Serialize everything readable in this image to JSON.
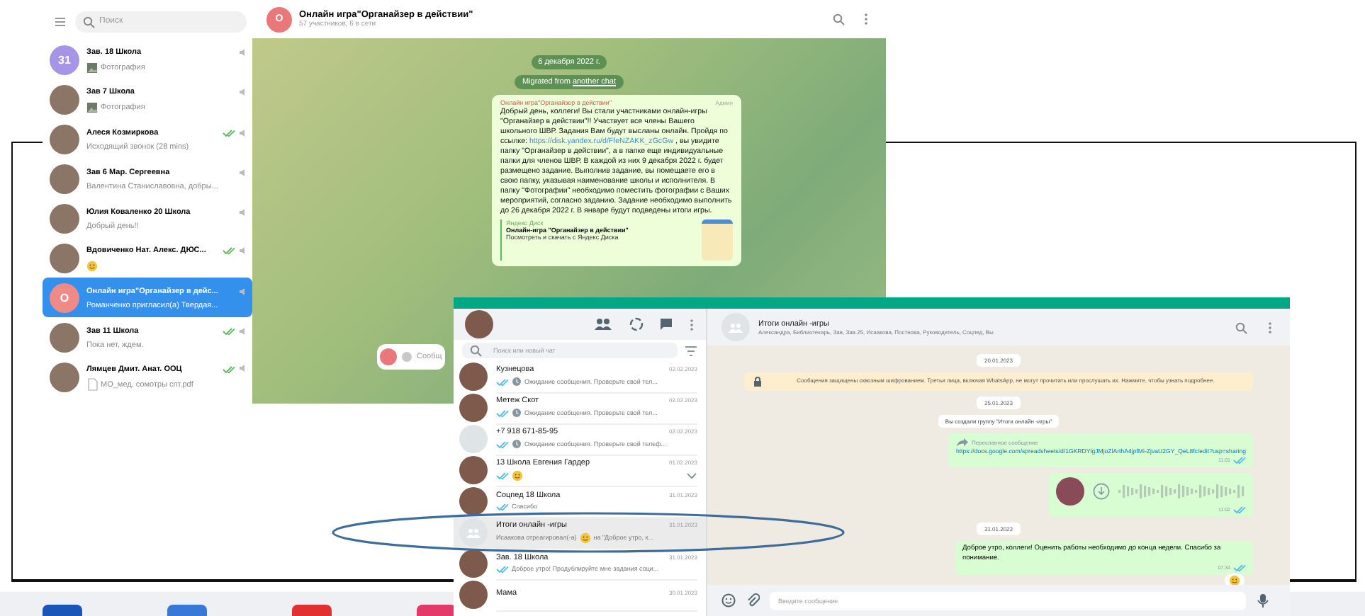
{
  "telegram": {
    "search": {
      "placeholder": "Поиск"
    },
    "chats": [
      {
        "avatar_text": "31",
        "color": "#a695e7",
        "name": "Зав. 18 Школа",
        "kind": "photo",
        "preview": "Фотография",
        "sent": false,
        "selected": false
      },
      {
        "name": "Зав 7 Школа",
        "kind": "photo",
        "preview": "Фотография",
        "sent": false,
        "selected": false
      },
      {
        "name": "Алеся Козмиркова",
        "kind": "text",
        "preview": "Исходящий звонок (28 mins)",
        "sent": true,
        "selected": false
      },
      {
        "name": "Зав 6 Мар. Сергеевна",
        "kind": "text",
        "preview": "Валентина Станиславовна, добры...",
        "sent": false,
        "selected": false
      },
      {
        "name": "Юлия Коваленко 20 Школа",
        "kind": "text",
        "preview": "Добрый день!!",
        "sent": false,
        "selected": false
      },
      {
        "name": "Вдовиченко Нат. Алекс. ДЮС...",
        "kind": "emoji",
        "sent": true,
        "selected": false
      },
      {
        "avatar_text": "О",
        "color": "#ef8a86",
        "name": "Онлайн игра\"Органайзер в дейс...",
        "kind": "text",
        "preview": "Романченко пригласил(а) Твердая...",
        "sent": false,
        "selected": true
      },
      {
        "name": "Зав 11 Школа",
        "kind": "text",
        "preview": "Пока нет, ждем.",
        "sent": true,
        "selected": false
      },
      {
        "name": "Лямцев Дмит. Анат. ООЦ",
        "kind": "file",
        "preview": "МО_мед. сомотры спт.pdf",
        "sent": true,
        "selected": false
      }
    ],
    "header": {
      "avatar_text": "О",
      "title": "Онлайн игра\"Органайзер в действии\"",
      "subtitle": "57 участников, 6 в сети"
    },
    "date": "6 декабря 2022 г.",
    "service": {
      "text": "Migrated from ",
      "link": "another chat"
    },
    "message": {
      "sender": "Онлайн игра\"Органайзер в действии\"",
      "role": "Админ",
      "text_before": "Добрый день, коллеги! Вы стали участниками онлайн-игры \"Органайзер в действии\"!! Участвует все члены Вашего школьного ШВР. Задания Вам будут высланы онлайн. Пройдя по ссылке: ",
      "link": "https://disk.yandex.ru/d/FfeNZAKK_zGcGw",
      "text_after": " , вы увидите папку \"Органайзер в действии\", а в папке еще индивидуальные папки для членов ШВР. В каждой из них 9 декабря 2022 г. будет размещено задание. Выполнив задание, вы помещаете его в свою папку, указывая наименование школы и исполнителя. В папку \"Фотографии\" необходимо поместить фотографии с Ваших мероприятий, согласно заданию. Задание необходимо выполнить до 26 декабря 2022 г. В январе будут подведены итоги игры.",
      "preview": {
        "site": "Яндекс Диск",
        "title": "Онлайн-игра \"Органайзер в действии\"",
        "description": "Посмотреть и скачать с Яндекс Диска"
      }
    },
    "input": {
      "placeholder": "Сообщ"
    }
  },
  "whatsapp": {
    "search": {
      "placeholder": "Поиск или новый чат"
    },
    "chats": [
      {
        "kind": "photo",
        "name": "Кузнецова",
        "date": "02.02.2023",
        "preview": "Ожидание сообщения. Проверьте свой тел...",
        "emoji": false,
        "waiting": true,
        "caret": false,
        "selected": false
      },
      {
        "kind": "photo",
        "name": "Метеж Скот",
        "date": "02.02.2023",
        "preview": "Ожидание сообщения. Проверьте свой тел...",
        "emoji": false,
        "waiting": true,
        "caret": false,
        "selected": false
      },
      {
        "kind": "blank",
        "name": "+7 918 671-85-95",
        "date": "02.02.2023",
        "preview": "Ожидание сообщения. Проверьте свой телеф...",
        "emoji": false,
        "waiting": true,
        "caret": false,
        "selected": false
      },
      {
        "kind": "photo",
        "name": "13 Школа Евгения Гардер",
        "date": "01.02.2023",
        "emoji": true,
        "waiting": false,
        "caret": true,
        "selected": false
      },
      {
        "kind": "photo",
        "name": "Соцпед 18 Школа",
        "date": "31.01.2023",
        "preview": "Спасибо",
        "emoji": false,
        "waiting": false,
        "caret": false,
        "selected": false
      },
      {
        "kind": "group",
        "name": "Итоги онлайн -игры",
        "date": "31.01.2023",
        "preview": "Исаакова отреагировал(-а)",
        "emoji": true,
        "preview_after": "на \"Доброе утро, к...",
        "waiting": false,
        "caret": false,
        "selected": true
      },
      {
        "kind": "photo",
        "name": "Зав. 18 Школа",
        "date": "31.01.2023",
        "preview": "Доброе утро! Продублируйте мне задания соци...",
        "emoji": false,
        "waiting": false,
        "caret": false,
        "selected": false
      },
      {
        "kind": "photo",
        "name": "Мама",
        "date": "30.01.2023",
        "emoji": false,
        "waiting": false,
        "caret": false,
        "selected": false
      }
    ],
    "header": {
      "title": "Итоги онлайн -игры",
      "subtitle": "Александра, Библиотекарь, Зав, Зав.25, Исаакова, Постнова, Руководитель, Соцпед, Вы"
    },
    "messages": [
      {
        "kind": "date",
        "text": "20.01.2023"
      },
      {
        "kind": "notice",
        "text": "Сообщения защищены сквозным шифрованием. Третьи лица, включая WhatsApp, не могут прочитать или прослушать их. Нажмите, чтобы узнать подробнее."
      },
      {
        "kind": "date",
        "text": "25.01.2023"
      },
      {
        "kind": "system",
        "text": "Вы создали группу \"Итоги онлайн -игры\""
      },
      {
        "kind": "forwarded",
        "label": "Пересланное сообщение",
        "text": "https://docs.google.com/spreadsheets/d/1GKRDYlgJMjoZlArthA4jpfMi-ZjvaU2GY_QeL8fc/edit?usp=sharing",
        "time": "11:01"
      },
      {
        "kind": "voice",
        "time": "11:02"
      },
      {
        "kind": "date",
        "text": "31.01.2023"
      },
      {
        "kind": "text",
        "text": "Доброе утро, коллеги! Оценить работы необходимо до конца недели. Спасибо за понимание.",
        "time": "07:34",
        "reaction": true
      }
    ],
    "input": {
      "placeholder": "Введите сообщение"
    }
  }
}
